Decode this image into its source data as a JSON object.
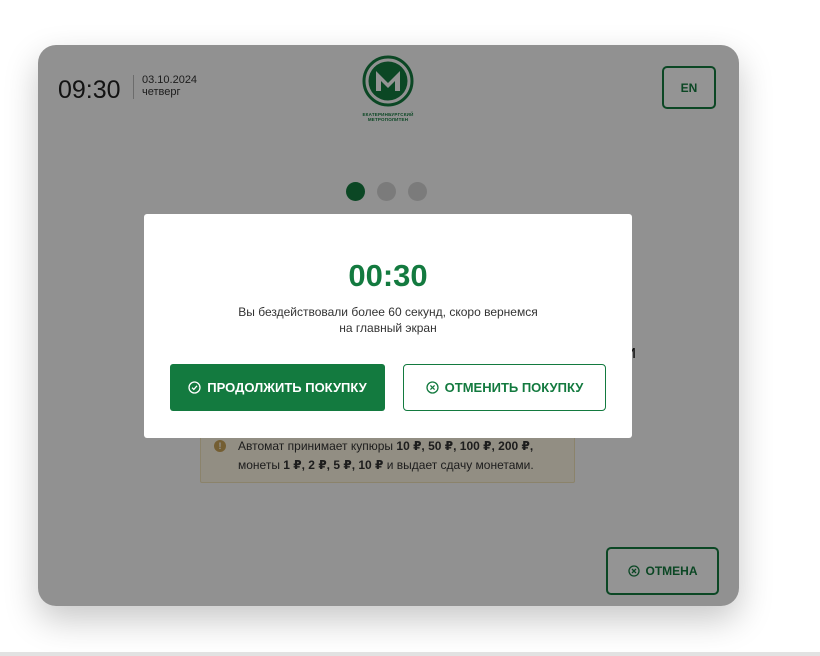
{
  "header": {
    "time": "09:30",
    "date": "03.10.2024",
    "weekday": "четверг",
    "logo_caption_line1": "ЕКАТЕРИНБУРГСКИЙ",
    "logo_caption_line2": "МЕТРОПОЛИТЕН",
    "language_button": "EN"
  },
  "background": {
    "title_tail": "и",
    "step_dots": {
      "total": 3,
      "active": 1
    },
    "notice": {
      "icon": "info-icon",
      "icon_glyph": "!",
      "line1_prefix": "Автомат принимает купюры ",
      "line1_bold": "10 ₽, 50 ₽, 100 ₽, 200 ₽,",
      "line2_prefix": "монеты ",
      "line2_bold": "1 ₽, 2 ₽, 5 ₽, 10 ₽",
      "line2_suffix": " и выдает сдачу монетами."
    },
    "cancel_button": {
      "label": "ОТМЕНА",
      "icon": "cancel-circle-icon"
    }
  },
  "modal": {
    "countdown": "00:30",
    "message_line1": "Вы бездействовали более 60 секунд, скоро вернемся",
    "message_line2": "на главный экран",
    "continue_button": {
      "label": "ПРОДОЛЖИТЬ ПОКУПКУ",
      "icon": "check-circle-icon"
    },
    "cancel_purchase_button": {
      "label": "ОТМЕНИТЬ ПОКУПКУ",
      "icon": "cancel-circle-icon"
    }
  },
  "colors": {
    "brand_green": "#137a3f",
    "overlay": "rgba(0,0,0,0.42)",
    "notice_bg": "#fbf4e2"
  }
}
